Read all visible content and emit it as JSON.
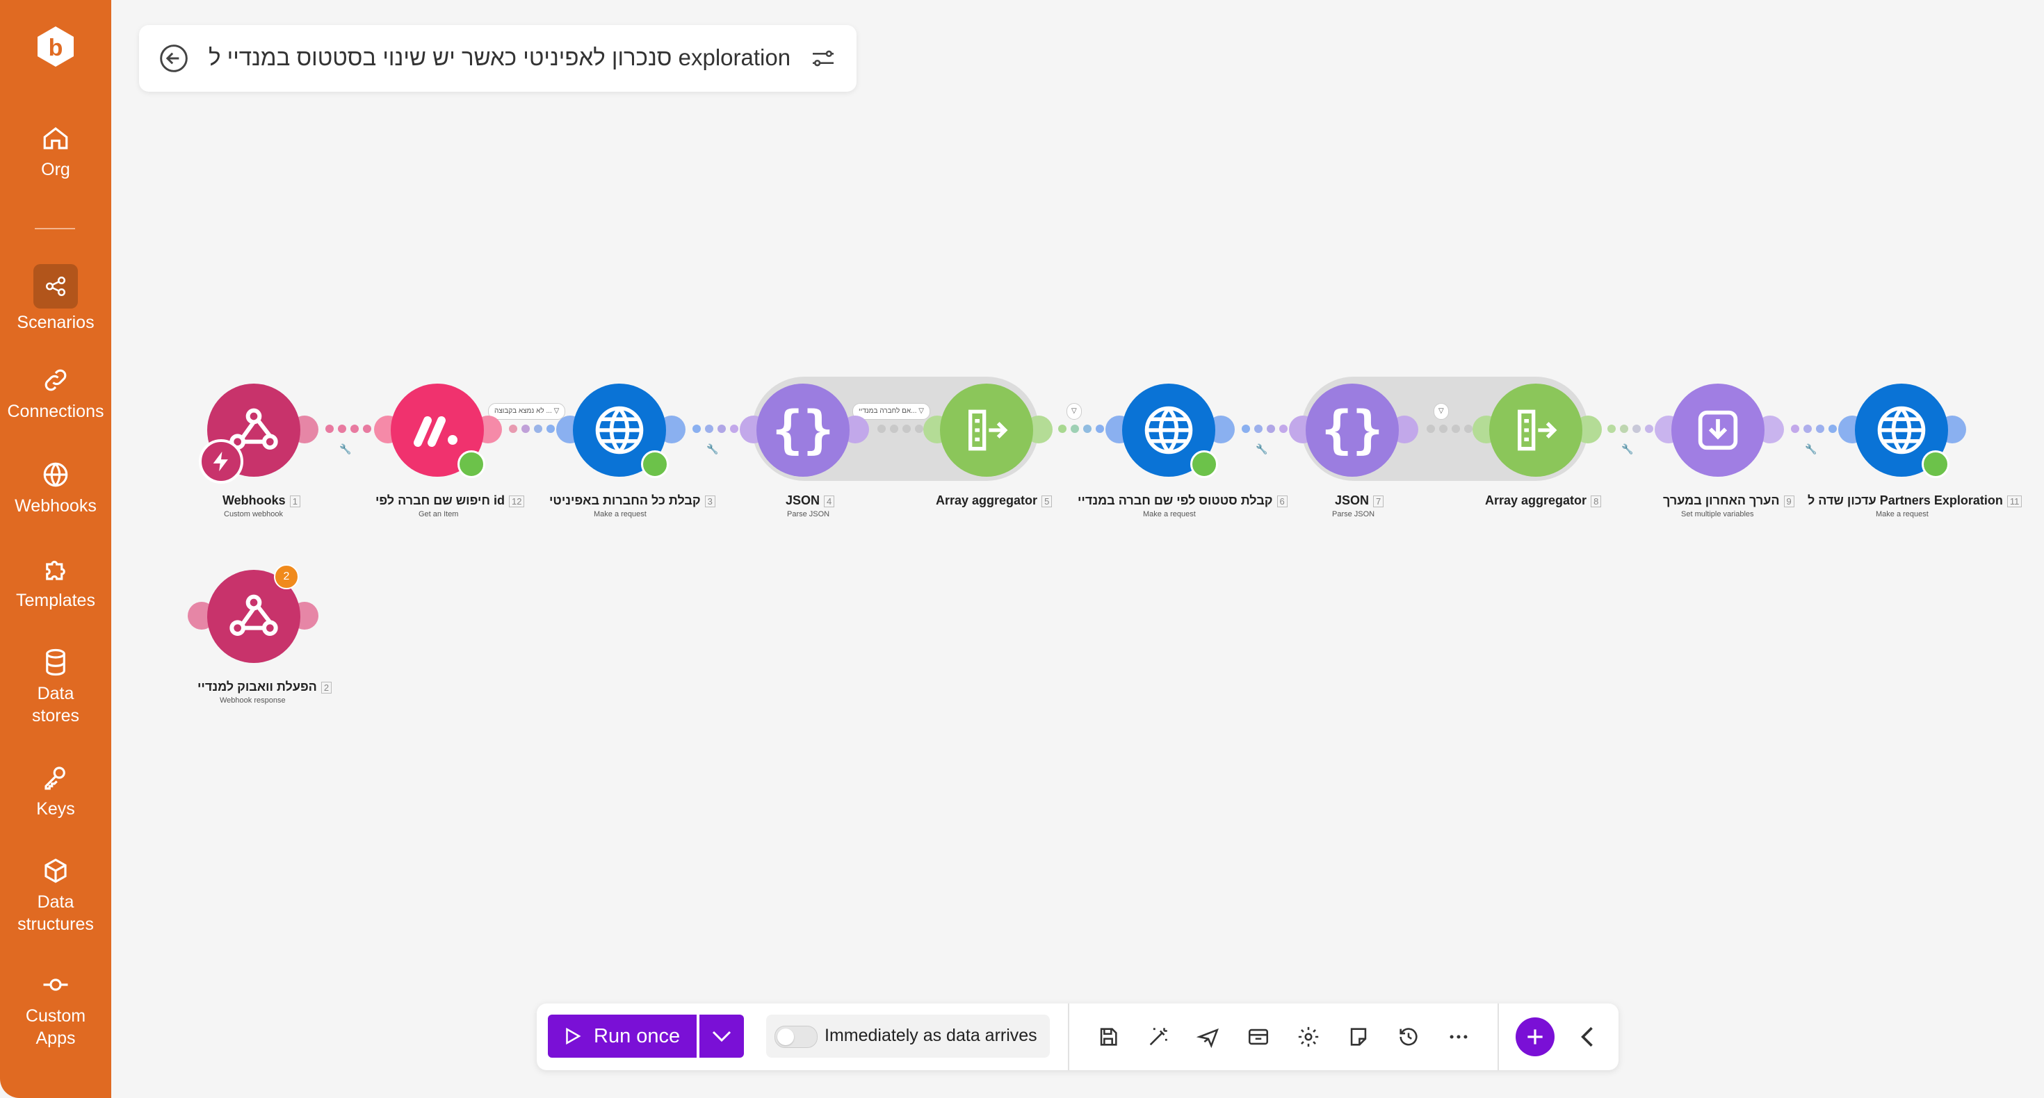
{
  "sidebar": {
    "items": [
      {
        "label": "Org",
        "icon": "home-icon"
      },
      {
        "label": "Scenarios",
        "icon": "share-icon"
      },
      {
        "label": "Connections",
        "icon": "link-icon"
      },
      {
        "label": "Webhooks",
        "icon": "globe-icon"
      },
      {
        "label": "Templates",
        "icon": "puzzle-icon"
      },
      {
        "label": "Data stores",
        "icon": "database-icon"
      },
      {
        "label": "Keys",
        "icon": "key-icon"
      },
      {
        "label": "Data structures",
        "icon": "cube-icon"
      },
      {
        "label": "Custom Apps",
        "icon": "commit-icon"
      }
    ],
    "active": "Scenarios",
    "color": "#e06a22"
  },
  "header": {
    "title": "סנכרון לאפיניטי כאשר יש שינוי בסטטוס במנדיי ל exploration"
  },
  "modules": [
    {
      "name": "Webhooks",
      "num": "1",
      "sub": "Custom webhook",
      "color": "#c8336b"
    },
    {
      "name": "חיפוש שם חברה לפי id",
      "num": "12",
      "sub": "Get an Item",
      "color": "#f0326e"
    },
    {
      "name": "קבלת כל החברות באפיניטי",
      "num": "3",
      "sub": "Make a request",
      "color": "#0a73d6"
    },
    {
      "name": "JSON",
      "num": "4",
      "sub": "Parse JSON",
      "color": "#9b7de0"
    },
    {
      "name": "Array aggregator",
      "num": "5",
      "sub": "",
      "color": "#8bc65a"
    },
    {
      "name": "קבלת סטטוס לפי שם חברה במנדיי",
      "num": "6",
      "sub": "Make a request",
      "color": "#0a73d6"
    },
    {
      "name": "JSON",
      "num": "7",
      "sub": "Parse JSON",
      "color": "#9b7de0"
    },
    {
      "name": "Array aggregator",
      "num": "8",
      "sub": "",
      "color": "#8bc65a"
    },
    {
      "name": "הערך האחרון במערך",
      "num": "9",
      "sub": "Set multiple variables",
      "color": "#a07ee3"
    },
    {
      "name": "עדכון שדה ל Partners Exploration",
      "num": "11",
      "sub": "Make a request",
      "color": "#0a73d6"
    },
    {
      "name": "הפעלת וואבוק למנדיי",
      "num": "2",
      "sub": "Webhook response",
      "color": "#c8336b"
    }
  ],
  "filters": {
    "f1": "לא נמצא בקבוצה ...",
    "f2": "אם לחברה במנדיי...",
    "f3": "",
    "f4": ""
  },
  "webhook_response_count": "2",
  "toolbar": {
    "run_label": "Run once",
    "schedule_label": "Immediately as data arrives",
    "accent": "#7a10d6"
  }
}
